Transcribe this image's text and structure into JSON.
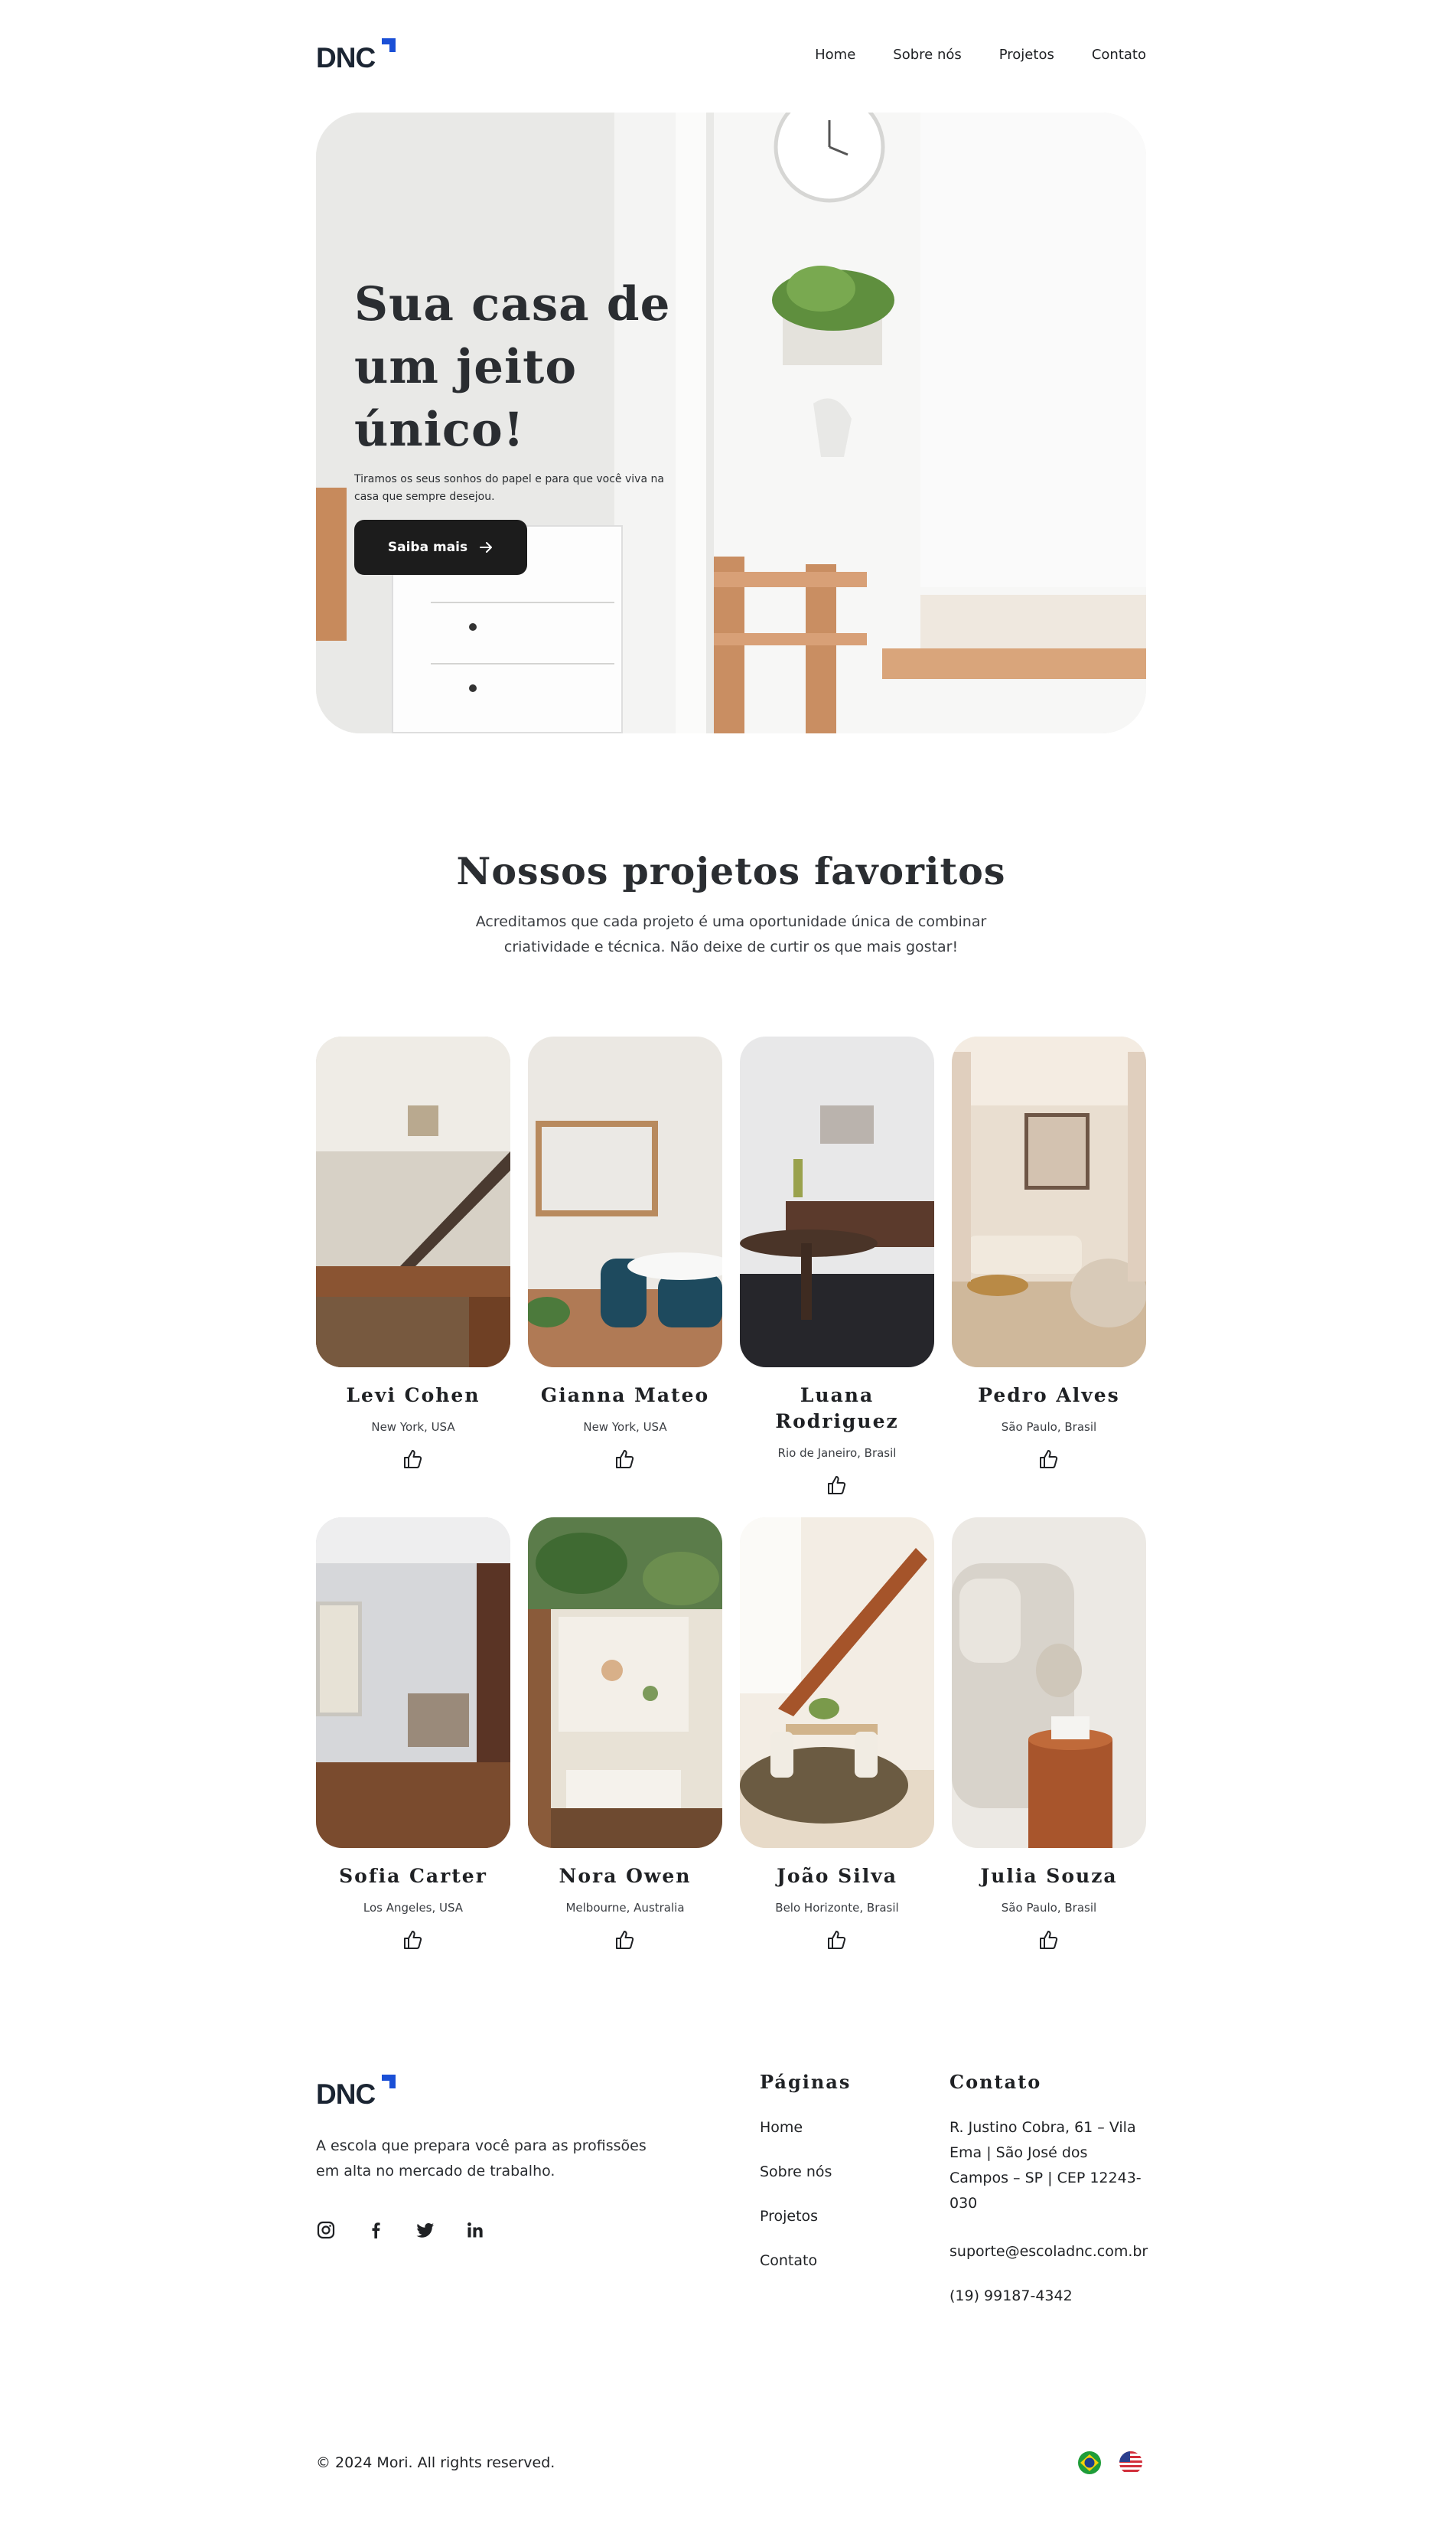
{
  "brand": {
    "name": "DNC",
    "accent": "#1a4fd6"
  },
  "nav": {
    "items": [
      "Home",
      "Sobre nós",
      "Projetos",
      "Contato"
    ]
  },
  "hero": {
    "title": "Sua casa de um jeito único!",
    "subtitle": "Tiramos os seus sonhos do papel e para que você viva na casa que sempre desejou.",
    "cta_label": "Saiba mais",
    "cta_icon": "arrow-right-icon"
  },
  "projects": {
    "title": "Nossos projetos favoritos",
    "subtitle": "Acreditamos que cada projeto é uma oportunidade única de combinar criatividade e técnica. Não deixe de curtir os que mais gostar!",
    "like_icon": "thumbs-up-icon",
    "items": [
      {
        "name": "Levi Cohen",
        "location": "New York, USA"
      },
      {
        "name": "Gianna Mateo",
        "location": "New York, USA"
      },
      {
        "name": "Luana Rodriguez",
        "location": "Rio de Janeiro, Brasil"
      },
      {
        "name": "Pedro Alves",
        "location": "São Paulo, Brasil"
      },
      {
        "name": "Sofia Carter",
        "location": "Los Angeles, USA"
      },
      {
        "name": "Nora Owen",
        "location": "Melbourne, Australia"
      },
      {
        "name": "João Silva",
        "location": "Belo Horizonte, Brasil"
      },
      {
        "name": "Julia Souza",
        "location": "São Paulo, Brasil"
      }
    ]
  },
  "footer": {
    "description": "A escola que prepara você para as profissões em alta no mercado de trabalho.",
    "socials": [
      "instagram-icon",
      "facebook-icon",
      "twitter-icon",
      "linkedin-icon"
    ],
    "pages": {
      "title": "Páginas",
      "links": [
        "Home",
        "Sobre nós",
        "Projetos",
        "Contato"
      ]
    },
    "contact": {
      "title": "Contato",
      "address": "R. Justino Cobra, 61 – Vila Ema | São José dos Campos – SP | CEP 12243-030",
      "email": "suporte@escoladnc.com.br",
      "phone": "(19) 99187-4342"
    },
    "copyright": "© 2024 Mori. All rights reserved.",
    "languages": [
      "brazil-flag-icon",
      "usa-flag-icon"
    ]
  }
}
